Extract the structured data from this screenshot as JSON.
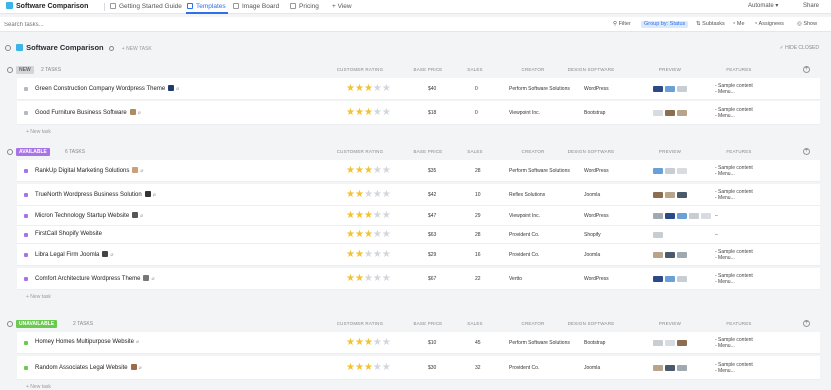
{
  "topbar": {
    "title": "Software Comparison",
    "tabs": [
      "Getting Started Guide",
      "Templates",
      "Image Board",
      "Pricing"
    ],
    "add_view": "+ View",
    "automate": "Automate",
    "share": "Share"
  },
  "toolbar": {
    "search_placeholder": "Search tasks...",
    "filter": "Filter",
    "group": "Group by: Status",
    "subtasks": "Subtasks",
    "me": "Me",
    "assignees": "Assignees",
    "show": "Show"
  },
  "list": {
    "title": "Software Comparison",
    "new_task": "+ NEW TASK",
    "hide_closed": "✓ HIDE CLOSED",
    "add_row": "+ New task"
  },
  "columns": {
    "rating": "CUSTOMER RATING",
    "price": "BASE PRICE",
    "sales": "SALES",
    "creator": "CREATOR",
    "software": "DESIGN SOFTWARE",
    "preview": "PREVIEW",
    "features": "FEATURES"
  },
  "groups": [
    {
      "status": "NEW",
      "count": "2 TASKS",
      "color": "#d3d5d9",
      "text_color": "#666",
      "rows": [
        {
          "name": "Green Construction Company Wordpress Theme",
          "rating": 3,
          "price": "$40",
          "sales": "0",
          "creator": "Perform Software Solutions",
          "software": "WordPress",
          "features": [
            "- Sample content",
            "- Menu..."
          ],
          "thumb": "#203a70",
          "clip": true
        },
        {
          "name": "Good Furniture Business Software",
          "rating": 3,
          "price": "$18",
          "sales": "0",
          "creator": "Viewpoint Inc.",
          "software": "Bootstrap",
          "features": [
            "- Sample content",
            "- Menu..."
          ],
          "thumb": "#b08a60",
          "clip": true
        }
      ]
    },
    {
      "status": "AVAILABLE",
      "count": "6 TASKS",
      "color": "#a873e8",
      "text_color": "#fff",
      "rows": [
        {
          "name": "RankUp Digital Marketing Solutions",
          "rating": 3,
          "price": "$35",
          "sales": "28",
          "creator": "Perform Software Solutions",
          "software": "WordPress",
          "features": [
            "- Sample content",
            "- Menu..."
          ],
          "thumb": "#c9a07a",
          "clip": true
        },
        {
          "name": "TrueNorth Wordpress Business Solution",
          "rating": 2,
          "price": "$42",
          "sales": "10",
          "creator": "Reflex Solutions",
          "software": "Joomla",
          "features": [
            "- Sample content",
            "- Menu..."
          ],
          "thumb": "#333",
          "clip": true
        },
        {
          "name": "Micron Technology Startup Website",
          "rating": 3,
          "price": "$47",
          "sales": "29",
          "creator": "Viewpoint Inc.",
          "software": "WordPress",
          "features": [
            "–"
          ],
          "thumb": "#555",
          "clip": true
        },
        {
          "name": "FirstCall Shopify Website",
          "rating": 3,
          "price": "$63",
          "sales": "28",
          "creator": "Provident Co.",
          "software": "Shopify",
          "features": [
            "–"
          ],
          "thumb": "",
          "clip": false
        },
        {
          "name": "Libra Legal Firm Joomla",
          "rating": 2,
          "price": "$29",
          "sales": "16",
          "creator": "Provident Co.",
          "software": "Joomla",
          "features": [
            "- Sample content",
            "- Menu..."
          ],
          "thumb": "#444",
          "clip": true
        },
        {
          "name": "Comfort Architecture Wordpress Theme",
          "rating": 2,
          "price": "$67",
          "sales": "22",
          "creator": "Vertto",
          "software": "WordPress",
          "features": [
            "- Sample content",
            "- Menu..."
          ],
          "thumb": "#777",
          "clip": true
        }
      ]
    },
    {
      "status": "UNAVAILABLE",
      "count": "2 TASKS",
      "color": "#6bc950",
      "text_color": "#fff",
      "rows": [
        {
          "name": "Homey Homes Multipurpose Website",
          "rating": 3,
          "price": "$10",
          "sales": "45",
          "creator": "Perform Software Solutions",
          "software": "Bootstrap",
          "features": [
            "- Sample content",
            "- Menu..."
          ],
          "thumb": "",
          "clip": true
        },
        {
          "name": "Random Associates Legal Website",
          "rating": 3,
          "price": "$30",
          "sales": "32",
          "creator": "Provident Co.",
          "software": "Joomla",
          "features": [
            "- Sample content",
            "- Menu..."
          ],
          "thumb": "#9a6a4a",
          "clip": true
        }
      ]
    }
  ]
}
